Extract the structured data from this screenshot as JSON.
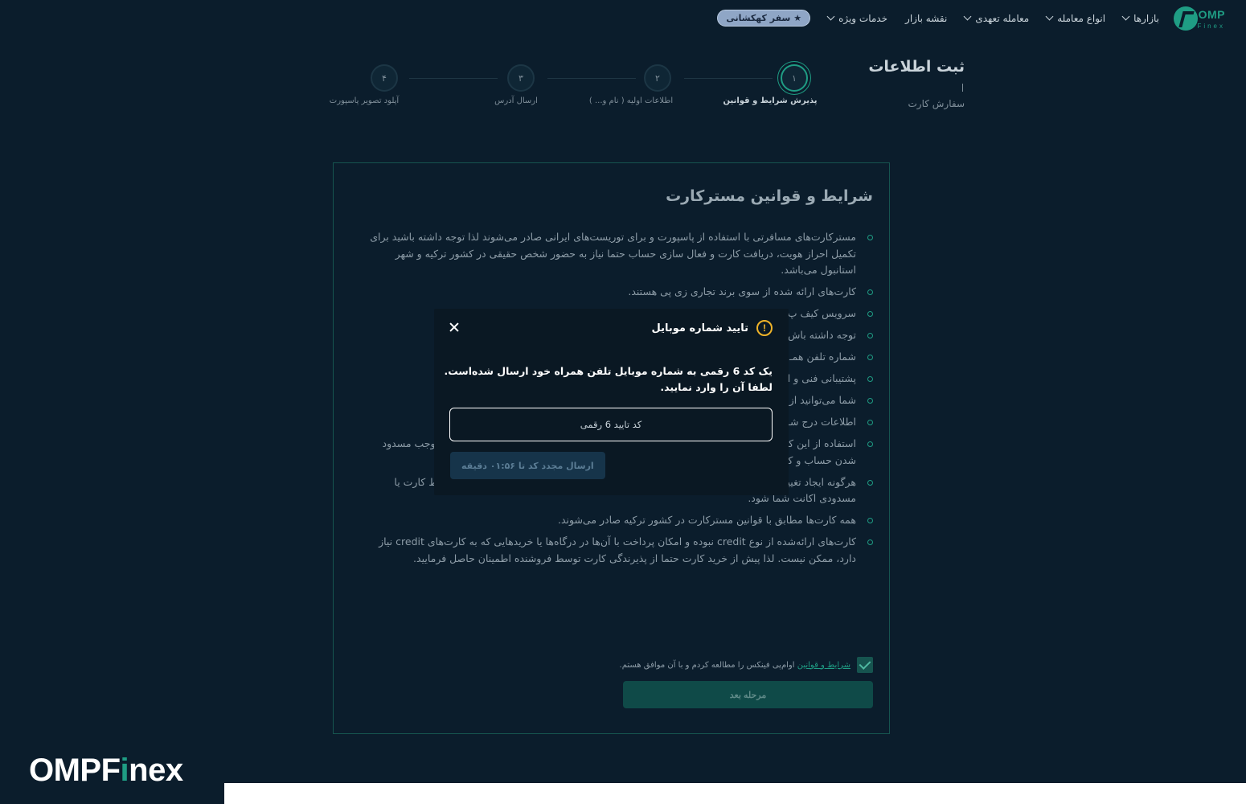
{
  "nav": {
    "brand": "OMP",
    "brand_sub": "Finex",
    "items": [
      {
        "label": "بازارها"
      },
      {
        "label": "انواع معامله"
      },
      {
        "label": "معامله تعهدی"
      },
      {
        "label": "نقشه بازار"
      },
      {
        "label": "خدمات ویژه"
      }
    ],
    "galaxy": "★ سفر کهکشانی"
  },
  "registration": {
    "title": "ثبت اطلاعات",
    "subtitle": "سفارش کارت",
    "steps": [
      {
        "num": "۱",
        "label": "پذیرش شرایط و قوانین",
        "active": true
      },
      {
        "num": "۲",
        "label": "اطلاعات اولیه ( نام و... )",
        "active": false
      },
      {
        "num": "۳",
        "label": "ارسال آدرس",
        "active": false
      },
      {
        "num": "۴",
        "label": "آپلود تصویر پاسپورت",
        "active": false
      }
    ]
  },
  "card": {
    "title": "شرایط و قوانین مسترکارت",
    "terms": [
      "مسترکارت‌های مسافرتی با استفاده از پاسپورت و برای توریست‌های ایرانی صادر می‌شوند لذا توجه داشته باشید برای تکمیل احراز هویت، دریافت کارت و فعال سازی حساب حتما نیاز به حضور شخص حقیقی در کشور ترکیه و شهر استانبول می‌باشد.",
      "کارت‌های ارائه شده از سوی برند تجاری زی پی هستند.",
      "سرویس کیف پ                                                                                                  ه و زیرنظر بانک مرکزی ترکیه و ه",
      "توجه داشته باش",
      "شماره تلفن همـ                                                                                                  ای ورود به پنل و اطلاعیه‌ها بر رو                                                                                                  ین شماره تماس اطمینان حاصل",
      "پشتیبانی فنی و                                                                                                  انجام خواهد شد.",
      "شما می‌توانید از",
      "اطلاعات درج شـ                                                                                                  ین انجام دهید. لذا لطفا به هیچ عنو",
      "استفاده از این کارت‌ها در سرویس‌های بت و شرطبندی و مواردی از این قبیل ممنوع بوده و می‌تواند موجب مسدود شدن حساب و کارت شما شود.",
      "هرگونه ایجاد تغییر در ظاهر کارت و یا ثبت نوشته و برچسب روی آن ممنوع بوده و می‌تواند موجب ضبط کارت یا مسدودی اکانت شما شود.",
      "همه کارت‌ها مطابق با قوانین مسترکارت در کشور ترکیه صادر می‌شوند.",
      "کارت‌های ارائه‌شده از نوع credit نبوده و امکان پرداخت با آن‌ها در درگاه‌ها یا خریدهایی که به کارت‌های credit نیاز دارد، ممکن نیست. لذا پیش از خرید کارت حتما از پذیرندگی کارت توسط فروشنده اطمینان حاصل فرمایید."
    ],
    "agree_link": "شرایط و قوانین",
    "agree_text": " اوام‌پی فینکس را مطالعه کردم و با آن موافق هستم.",
    "next_label": "مرحله بعد"
  },
  "modal": {
    "title": "تایید شماره موبایل",
    "warn_glyph": "!",
    "message": "یک کد 6 رقمی به شماره موبایل تلفن همراه خود ارسال شده‌است. لطفا آن را وارد نمایید.",
    "code_placeholder": "کد تایید 6 رقمی",
    "resend_label": "ارسال مجدد کد تا ۰۱:۵۶ دقیقه"
  },
  "footer": {
    "brand_a": "OMPF",
    "brand_b": "i",
    "brand_c": "nex"
  }
}
